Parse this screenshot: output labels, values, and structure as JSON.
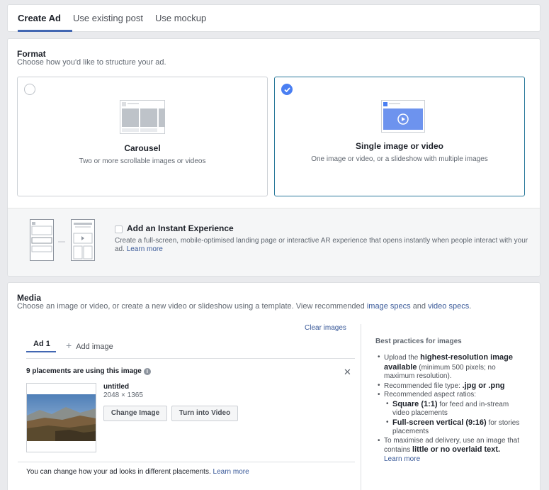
{
  "tabs": {
    "create_ad": "Create Ad",
    "use_existing": "Use existing post",
    "use_mockup": "Use mockup"
  },
  "format": {
    "title": "Format",
    "subtitle": "Choose how you'd like to structure your ad.",
    "carousel": {
      "title": "Carousel",
      "desc": "Two or more scrollable images or videos"
    },
    "single": {
      "title": "Single image or video",
      "desc": "One image or video, or a slideshow with multiple images"
    },
    "instant": {
      "title": "Add an Instant Experience",
      "desc": "Create a full-screen, mobile-optimised landing page or interactive AR experience that opens instantly when people interact with your ad.",
      "learn_more": "Learn more"
    }
  },
  "media": {
    "title": "Media",
    "subtitle_prefix": "Choose an image or video, or create a new video or slideshow using a template. View recommended",
    "image_specs": "image specs",
    "and": "and",
    "video_specs": "video specs",
    "clear_images": "Clear images",
    "ad_tab": "Ad 1",
    "add_image": "Add image",
    "placements": "9 placements are using this image",
    "file_name": "untitled",
    "file_dims": "2048 × 1365",
    "change_image": "Change Image",
    "turn_into_video": "Turn into Video",
    "can_change": "You can change how your ad looks in different placements.",
    "learn_more": "Learn more"
  },
  "best_practices": {
    "title": "Best practices for images",
    "b1_pre": "Upload the",
    "b1_bold": "highest-resolution image available",
    "b1_post": "(minimum 500 pixels; no maximum resolution).",
    "b2_pre": "Recommended file type:",
    "b2_bold": ".jpg or .png",
    "b3": "Recommended aspect ratios:",
    "s1_bold": "Square (1:1)",
    "s1_post": "for feed and in-stream video placements",
    "s2_bold": "Full-screen vertical (9:16)",
    "s2_post": "for stories placements",
    "b4_pre": "To maximise ad delivery, use an image that contains",
    "b4_bold": "little or no overlaid text.",
    "learn_more": "Learn more"
  }
}
